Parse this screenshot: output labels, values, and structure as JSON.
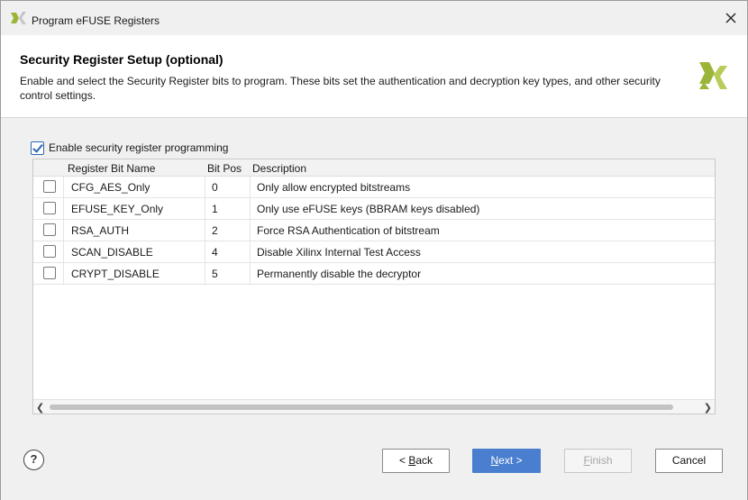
{
  "window": {
    "title": "Program eFUSE Registers",
    "icon": "xilinx-logo-icon"
  },
  "header": {
    "title": "Security Register Setup (optional)",
    "description": "Enable and select the Security Register bits to program. These bits set the authentication and decryption key types, and other security control settings."
  },
  "enable": {
    "label": "Enable security register programming",
    "checked": true
  },
  "table": {
    "columns": [
      "",
      "Register Bit Name",
      "Bit Pos",
      "Description"
    ],
    "rows": [
      {
        "checked": false,
        "name": "CFG_AES_Only",
        "pos": "0",
        "desc": "Only allow encrypted bitstreams"
      },
      {
        "checked": false,
        "name": "EFUSE_KEY_Only",
        "pos": "1",
        "desc": "Only use eFUSE keys (BBRAM keys disabled)"
      },
      {
        "checked": false,
        "name": "RSA_AUTH",
        "pos": "2",
        "desc": "Force RSA Authentication of bitstream"
      },
      {
        "checked": false,
        "name": "SCAN_DISABLE",
        "pos": "4",
        "desc": "Disable Xilinx Internal Test Access"
      },
      {
        "checked": false,
        "name": "CRYPT_DISABLE",
        "pos": "5",
        "desc": "Permanently disable the decryptor"
      }
    ]
  },
  "footer": {
    "help": "?",
    "back_prefix": "< ",
    "back_mn": "B",
    "back_rest": "ack",
    "next_mn": "N",
    "next_rest": "ext >",
    "finish_mn": "F",
    "finish_rest": "inish",
    "cancel": "Cancel"
  },
  "colors": {
    "accent": "#4a7fd0",
    "logo": "#9bb53a"
  }
}
